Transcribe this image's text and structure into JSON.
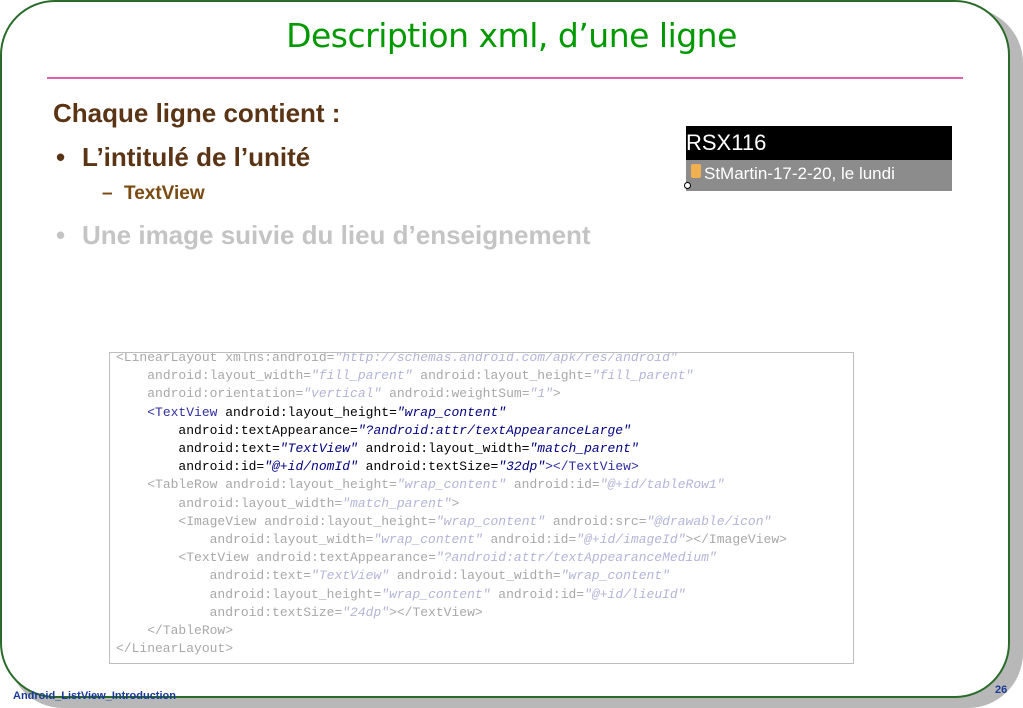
{
  "slide": {
    "title": "Description xml, d’une ligne",
    "heading": "Chaque ligne contient :",
    "bullets": [
      {
        "marker": "•",
        "text": "L’intitulé de l’unité",
        "sub": {
          "marker": "–",
          "text": "TextView"
        }
      },
      {
        "marker": "•",
        "text": "Une image suivie du lieu d’enseignement"
      }
    ],
    "footer": "Android_ListView_Introduction",
    "page_number": "26"
  },
  "preview": {
    "header": "RSX116",
    "row_text": "StMartin-17-2-20, le lundi"
  },
  "code": [
    {
      "indent": "",
      "parts": [
        [
          "faded",
          "<LinearLayout xmlns:android="
        ],
        [
          "faded-val",
          "\"http://schemas.android.com/apk/res/android\""
        ]
      ]
    },
    {
      "indent": "    ",
      "parts": [
        [
          "faded",
          "android:layout_width="
        ],
        [
          "faded-val",
          "\"fill_parent\""
        ],
        [
          "faded",
          " android:layout_height="
        ],
        [
          "faded-val",
          "\"fill_parent\""
        ]
      ]
    },
    {
      "indent": "    ",
      "parts": [
        [
          "faded",
          "android:orientation="
        ],
        [
          "faded-val",
          "\"vertical\""
        ],
        [
          "faded",
          " android:weightSum="
        ],
        [
          "faded-val",
          "\"1\""
        ],
        [
          "faded",
          ">"
        ]
      ]
    },
    {
      "indent": "    ",
      "parts": [
        [
          "tag",
          "<TextView"
        ],
        [
          "attr",
          " android:layout_height="
        ],
        [
          "val",
          "\"wrap_content\""
        ]
      ]
    },
    {
      "indent": "        ",
      "parts": [
        [
          "attr",
          "android:textAppearance="
        ],
        [
          "val",
          "\"?android:attr/textAppearanceLarge\""
        ]
      ]
    },
    {
      "indent": "        ",
      "parts": [
        [
          "attr",
          "android:text="
        ],
        [
          "val",
          "\"TextView\""
        ],
        [
          "attr",
          " android:layout_width="
        ],
        [
          "val",
          "\"match_parent\""
        ]
      ]
    },
    {
      "indent": "        ",
      "parts": [
        [
          "attr",
          "android:id="
        ],
        [
          "val",
          "\"@+id/nomId\""
        ],
        [
          "attr",
          " android:textSize="
        ],
        [
          "val",
          "\"32dp\""
        ],
        [
          "tag",
          "></TextView>"
        ]
      ]
    },
    {
      "indent": "    ",
      "parts": [
        [
          "faded",
          "<TableRow android:layout_height="
        ],
        [
          "faded-val",
          "\"wrap_content\""
        ],
        [
          "faded",
          " android:id="
        ],
        [
          "faded-val",
          "\"@+id/tableRow1\""
        ]
      ]
    },
    {
      "indent": "        ",
      "parts": [
        [
          "faded",
          "android:layout_width="
        ],
        [
          "faded-val",
          "\"match_parent\""
        ],
        [
          "faded",
          ">"
        ]
      ]
    },
    {
      "indent": "        ",
      "parts": [
        [
          "faded",
          "<ImageView android:layout_height="
        ],
        [
          "faded-val",
          "\"wrap_content\""
        ],
        [
          "faded",
          " android:src="
        ],
        [
          "faded-val",
          "\"@drawable/icon\""
        ]
      ]
    },
    {
      "indent": "            ",
      "parts": [
        [
          "faded",
          "android:layout_width="
        ],
        [
          "faded-val",
          "\"wrap_content\""
        ],
        [
          "faded",
          " android:id="
        ],
        [
          "faded-val",
          "\"@+id/imageId\""
        ],
        [
          "faded",
          "></ImageView>"
        ]
      ]
    },
    {
      "indent": "        ",
      "parts": [
        [
          "faded",
          "<TextView android:textAppearance="
        ],
        [
          "faded-val",
          "\"?android:attr/textAppearanceMedium\""
        ]
      ]
    },
    {
      "indent": "            ",
      "parts": [
        [
          "faded",
          "android:text="
        ],
        [
          "faded-val",
          "\"TextView\""
        ],
        [
          "faded",
          " android:layout_width="
        ],
        [
          "faded-val",
          "\"wrap_content\""
        ]
      ]
    },
    {
      "indent": "            ",
      "parts": [
        [
          "faded",
          "android:layout_height="
        ],
        [
          "faded-val",
          "\"wrap_content\""
        ],
        [
          "faded",
          " android:id="
        ],
        [
          "faded-val",
          "\"@+id/lieuId\""
        ]
      ]
    },
    {
      "indent": "            ",
      "parts": [
        [
          "faded",
          "android:textSize="
        ],
        [
          "faded-val",
          "\"24dp\""
        ],
        [
          "faded",
          "></TextView>"
        ]
      ]
    },
    {
      "indent": "    ",
      "parts": [
        [
          "faded",
          "</TableRow>"
        ]
      ]
    },
    {
      "indent": "",
      "parts": [
        [
          "faded",
          "</LinearLayout>"
        ]
      ]
    }
  ]
}
